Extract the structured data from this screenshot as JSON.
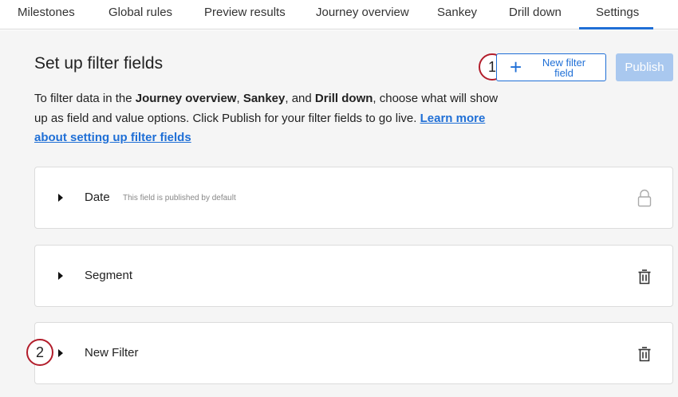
{
  "tabs": [
    {
      "label": "Milestones"
    },
    {
      "label": "Global rules"
    },
    {
      "label": "Preview results"
    },
    {
      "label": "Journey overview"
    },
    {
      "label": "Sankey"
    },
    {
      "label": "Drill down"
    },
    {
      "label": "Settings",
      "active": true
    }
  ],
  "header": {
    "title": "Set up filter fields",
    "new_filter_label": "New filter field",
    "publish_label": "Publish"
  },
  "callouts": [
    "1",
    "2"
  ],
  "description": {
    "part1": "To filter data in the ",
    "b1": "Journey overview",
    "part2": ", ",
    "b2": "Sankey",
    "part3": ", and ",
    "b3": "Drill down",
    "part4": ", choose what will show up as field and value options. Click Publish for your filter fields to go live. ",
    "link": "Learn more about setting up filter fields"
  },
  "fields": [
    {
      "label": "Date",
      "note": "This field is published by default",
      "icon": "lock-icon"
    },
    {
      "label": "Segment",
      "icon": "trash-icon"
    },
    {
      "label": "New Filter",
      "icon": "trash-icon"
    }
  ],
  "colors": {
    "accent": "#1f6fd6",
    "callout": "#b21d2b",
    "publish_disabled": "#a9c8ef"
  }
}
